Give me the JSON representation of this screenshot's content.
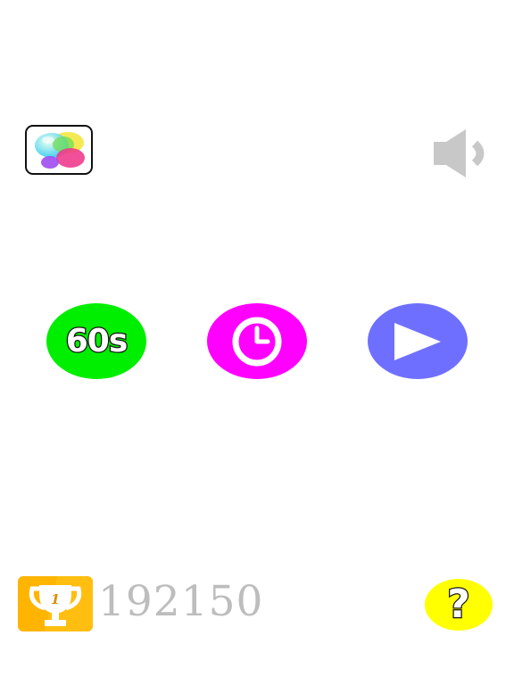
{
  "colors": {
    "background": "#ffffff",
    "mode_60s": "#00ee00",
    "mode_timer": "#ff00ff",
    "mode_play": "#6f6fff",
    "trophy_bg": "#ffb400",
    "score_text": "#bdbdbd",
    "help_bg": "#ffff00",
    "sound_icon": "#c8c8c8"
  },
  "header": {
    "game_center_icon": "game-center-bubbles-icon",
    "sound_icon": "speaker-icon"
  },
  "modes": {
    "sixty_label": "60s",
    "timer_icon": "clock-icon",
    "play_icon": "play-icon"
  },
  "footer": {
    "trophy_icon": "trophy-icon",
    "trophy_rank": "1",
    "best_score": "192150",
    "help_label": "?"
  }
}
